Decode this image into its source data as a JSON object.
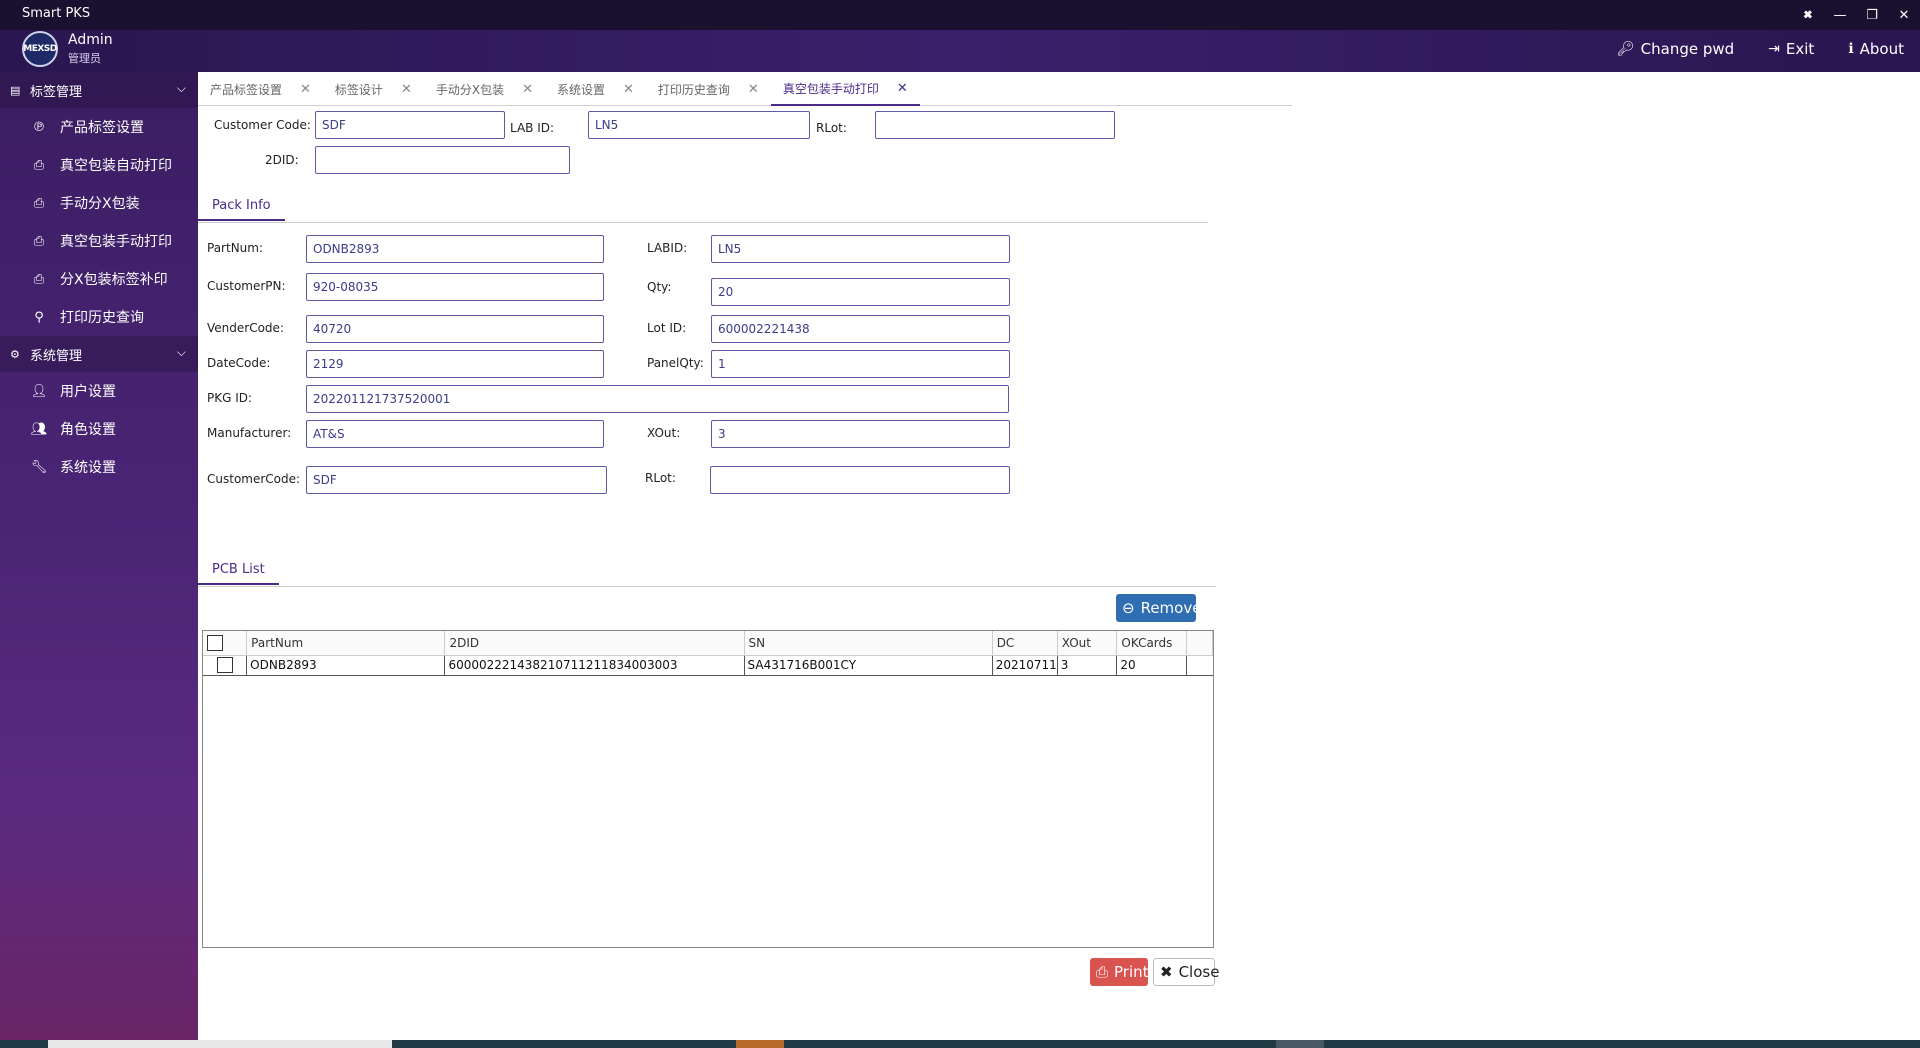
{
  "app": {
    "title": "Smart PKS"
  },
  "window_controls": {
    "pin": "🞮",
    "min": "—",
    "restore": "❐",
    "close": "✕"
  },
  "user": {
    "avatar_text": "MEXSD",
    "name": "Admin",
    "role": "管理员"
  },
  "header": {
    "change_pwd": "Change pwd",
    "exit": "Exit",
    "about": "About"
  },
  "sidebar": {
    "groups": [
      {
        "label": "标签管理",
        "items": [
          {
            "label": "产品标签设置",
            "icon": "product-icon"
          },
          {
            "label": "真空包装自动打印",
            "icon": "print-icon"
          },
          {
            "label": "手动分X包装",
            "icon": "print-icon"
          },
          {
            "label": "真空包装手动打印",
            "icon": "print-icon"
          },
          {
            "label": "分X包装标签补印",
            "icon": "print-icon"
          },
          {
            "label": "打印历史查询",
            "icon": "search-icon"
          }
        ]
      },
      {
        "label": "系统管理",
        "items": [
          {
            "label": "用户设置",
            "icon": "user-icon"
          },
          {
            "label": "角色设置",
            "icon": "users-icon"
          },
          {
            "label": "系统设置",
            "icon": "wrench-icon"
          }
        ]
      }
    ]
  },
  "tabs": [
    {
      "label": "产品标签设置"
    },
    {
      "label": "标签设计"
    },
    {
      "label": "手动分X包装"
    },
    {
      "label": "系统设置"
    },
    {
      "label": "打印历史查询"
    },
    {
      "label": "真空包装手动打印",
      "active": true
    }
  ],
  "top_form": {
    "customer_code_label": "Customer Code:",
    "customer_code": "SDF",
    "lab_id_label": "LAB ID:",
    "lab_id": "LN5",
    "rlot_label": "RLot:",
    "rlot": "",
    "twodid_label": "2DID:",
    "twodid": ""
  },
  "pack_info": {
    "section_label": "Pack Info",
    "partnum_label": "PartNum:",
    "partnum": "ODNB2893",
    "labid_label": "LABID:",
    "labid": "LN5",
    "customerpn_label": "CustomerPN:",
    "customerpn": "920-08035",
    "qty_label": "Qty:",
    "qty": "20",
    "vendercode_label": "VenderCode:",
    "vendercode": "40720",
    "lotid_label": "Lot ID:",
    "lotid": "600002221438",
    "datecode_label": "DateCode:",
    "datecode": "2129",
    "panelqty_label": "PanelQty:",
    "panelqty": "1",
    "pkgid_label": "PKG ID:",
    "pkgid": "202201121737520001",
    "manufacturer_label": "Manufacturer:",
    "manufacturer": "AT&S",
    "xout_label": "XOut:",
    "xout": "3",
    "customercode_label": "CustomerCode:",
    "customercode": "SDF",
    "rlot_label": "RLot:",
    "rlot": ""
  },
  "pcb_list": {
    "section_label": "PCB List",
    "remove_label": "Remove",
    "columns": [
      "PartNum",
      "2DID",
      "SN",
      "DC",
      "XOut",
      "OKCards"
    ],
    "rows": [
      [
        "ODNB2893",
        "600002221438210711211834003003",
        "SA431716B001CY",
        "20210711",
        "3",
        "20"
      ]
    ]
  },
  "footer": {
    "print_label": "Print",
    "close_label": "Close"
  },
  "colors": {
    "accent": "#4b2b8a",
    "remove": "#2f6eb0",
    "print": "#d9534f"
  }
}
